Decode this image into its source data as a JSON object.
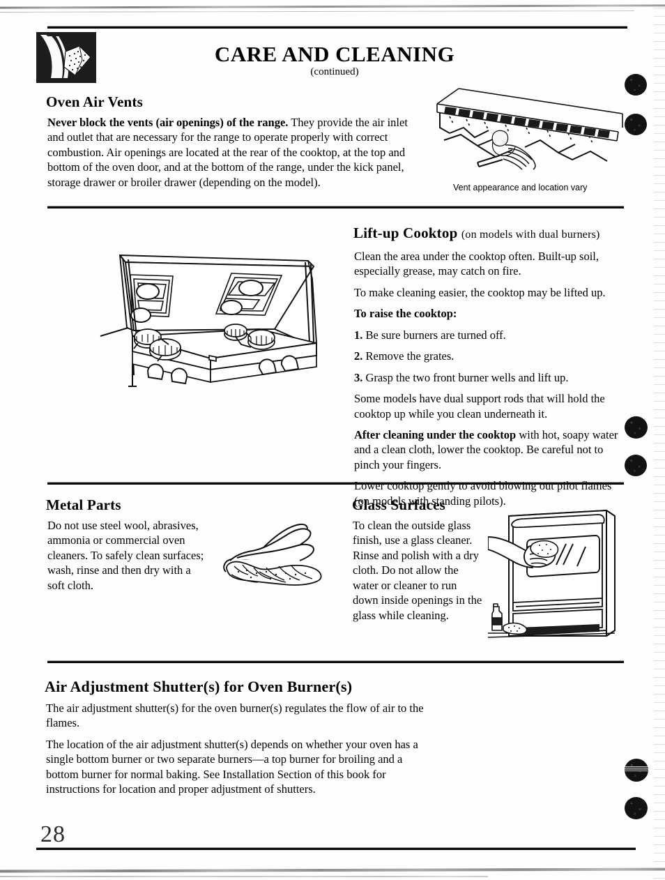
{
  "document": {
    "header_title": "CARE AND CLEANING",
    "header_subtitle": "(continued)",
    "header_icon": "hand-with-sponge-icon",
    "page_number": "28"
  },
  "sections": {
    "oven_air_vents": {
      "heading": "Oven Air Vents",
      "lead_bold": "Never block the vents (air openings) of the range.",
      "body": " They provide the air inlet and outlet that are necessary for the range to operate properly with correct combustion. Air openings are located at the rear of the cooktop, at the top and bottom of the oven door, and at the bottom of the range, under the kick panel, storage drawer or broiler drawer (depending on the model).",
      "figure_name": "range-vent-illustration",
      "figure_caption": "Vent appearance and location vary"
    },
    "lift_up_cooktop": {
      "heading": "Lift-up Cooktop",
      "heading_qualifier": "(on models with dual burners)",
      "figure_name": "lifted-cooktop-illustration",
      "paragraph_1": "Clean the area under the cooktop often. Built-up soil, especially grease, may catch on fire.",
      "paragraph_2": "To make cleaning easier, the cooktop may be lifted up.",
      "steps_intro": "To raise the cooktop:",
      "steps": [
        {
          "number": "1.",
          "text": "Be sure burners are turned off."
        },
        {
          "number": "2.",
          "text": "Remove the grates."
        },
        {
          "number": "3.",
          "text": "Grasp the two front burner wells and lift up."
        }
      ],
      "paragraph_3": "Some models have dual support rods that will hold the cooktop up while you clean underneath it.",
      "paragraph_4_bold": "After cleaning under the cooktop",
      "paragraph_4": " with hot, soapy water and a clean cloth, lower the cooktop. Be careful not to pinch your fingers.",
      "paragraph_5": "Lower cooktop gently to avoid blowing out pilot flames (on models with standing pilots)."
    },
    "metal_parts": {
      "heading": "Metal Parts",
      "body": "Do not use steel wool, abrasives, ammonia or commercial oven cleaners. To safely clean surfaces; wash, rinse and then dry with a soft cloth.",
      "figure_name": "hand-wiping-cloth-illustration"
    },
    "glass_surfaces": {
      "heading": "Glass Surfaces",
      "body": "To clean the outside glass finish, use a glass cleaner. Rinse and polish with a dry cloth. Do not allow the water or cleaner to run down inside openings in the glass while cleaning.",
      "figure_name": "oven-door-glass-cleaning-illustration"
    },
    "air_adjustment": {
      "heading": "Air Adjustment Shutter(s) for Oven Burner(s)",
      "paragraph_1": "The air adjustment shutter(s) for the oven burner(s) regulates the flow of air to the flames.",
      "paragraph_2": "The location of the air adjustment shutter(s) depends on whether your oven has a single bottom burner or two separate burners—a top burner for broiling and a bottom burner for normal baking. See Installation Section of this book for instructions for location and proper adjustment of shutters."
    }
  },
  "colors": {
    "ink": "#000000",
    "paper": "#fefefe",
    "icon_box": "#1a1a1a"
  }
}
